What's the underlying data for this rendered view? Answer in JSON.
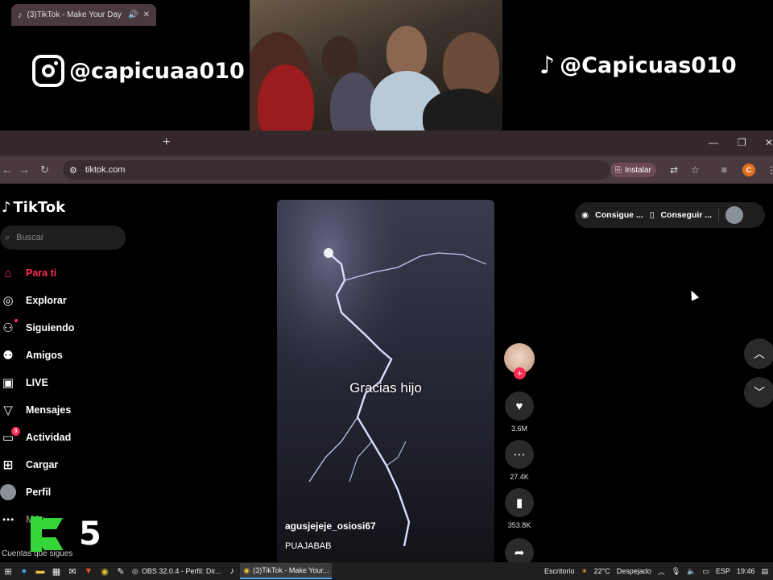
{
  "overlay": {
    "instagram_handle": "@capicuaa010",
    "tiktok_handle": "@Capicuas010",
    "counter": "5"
  },
  "browser": {
    "tab_title": "(3)TikTok - Make Your Day",
    "url": "tiktok.com",
    "install_label": "Instalar",
    "profile_letter": "C"
  },
  "sidebar": {
    "brand": "TikTok",
    "search_placeholder": "Buscar",
    "items": [
      {
        "label": "Para ti",
        "icon": "home-icon"
      },
      {
        "label": "Explorar",
        "icon": "compass-icon"
      },
      {
        "label": "Siguiendo",
        "icon": "following-icon"
      },
      {
        "label": "Amigos",
        "icon": "friends-icon"
      },
      {
        "label": "LIVE",
        "icon": "live-icon"
      },
      {
        "label": "Mensajes",
        "icon": "messages-icon"
      },
      {
        "label": "Actividad",
        "icon": "activity-icon",
        "badge": "3"
      },
      {
        "label": "Cargar",
        "icon": "upload-icon"
      },
      {
        "label": "Perfil",
        "icon": "profile-avatar"
      },
      {
        "label": "Más",
        "icon": "more-icon"
      }
    ],
    "following_accounts_label": "Cuentas que sigues"
  },
  "video": {
    "caption": "Gracias hijo",
    "author": "agusjejeje_osiosi67",
    "description": "PUAJABAB",
    "likes": "3.6M",
    "comments": "27.4K",
    "saves": "353.8K"
  },
  "promo": {
    "item1": "Consigue ...",
    "item2": "Conseguir ..."
  },
  "taskbar": {
    "obs_label": "OBS 32.0.4 - Perfil: Dir...",
    "chrome_label": "(3)TikTok - Make Your...",
    "desktop_label": "Escritorio",
    "weather_temp": "22°C",
    "weather_desc": "Despejado",
    "lang": "ESP",
    "time": "19:46"
  }
}
